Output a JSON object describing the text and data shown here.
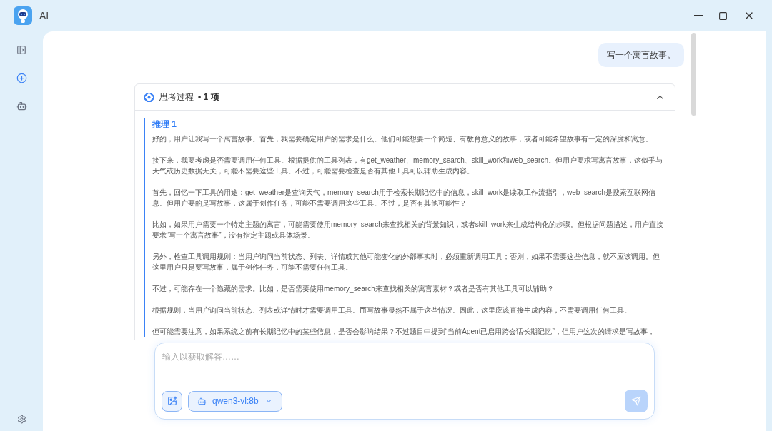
{
  "window": {
    "title": "AI"
  },
  "sidebar": {
    "items": [
      {
        "kind": "panel"
      },
      {
        "kind": "new-chat",
        "selected": true
      },
      {
        "kind": "agent",
        "selected": false
      }
    ]
  },
  "user_message": "写一个寓言故事。",
  "thinking": {
    "title": "思考过程",
    "count": "• 1 项",
    "expanded": true,
    "step_title": "推理 1",
    "paragraphs": [
      "好的，用户让我写一个寓言故事。首先，我需要确定用户的需求是什么。他们可能想要一个简短、有教育意义的故事，或者可能希望故事有一定的深度和寓意。",
      "接下来，我要考虑是否需要调用任何工具。根据提供的工具列表，有get_weather、memory_search、skill_work和web_search。但用户要求写寓言故事，这似乎与天气或历史数据无关，可能不需要这些工具。不过，可能需要检查是否有其他工具可以辅助生成内容。",
      "首先，回忆一下工具的用途：get_weather是查询天气，memory_search用于检索长期记忆中的信息，skill_work是读取工作流指引，web_search是搜索互联网信息。但用户要的是写故事，这属于创作任务，可能不需要调用这些工具。不过，是否有其他可能性？",
      "比如，如果用户需要一个特定主题的寓言，可能需要使用memory_search来查找相关的背景知识，或者skill_work来生成结构化的步骤。但根据问题描述，用户直接要求“写一个寓言故事”，没有指定主题或具体场景。",
      "另外，检查工具调用规则：当用户询问当前状态、列表、详情或其他可能变化的外部事实时，必须重新调用工具；否则，如果不需要这些信息，就不应该调用。但这里用户只是要写故事，属于创作任务，可能不需要任何工具。",
      "不过，可能存在一个隐藏的需求。比如，是否需要使用memory_search来查找相关的寓言素材？或者是否有其他工具可以辅助？",
      "根据规则，当用户询问当前状态、列表或详情时才需要调用工具。而写故事显然不属于这些情况。因此，这里应该直接生成内容，不需要调用任何工具。",
      "但可能需要注意，如果系统之前有长期记忆中的某些信息，是否会影响结果？不过题目中提到“当前Agent已启用跨会话长期记忆”，但用户这次的请求是写故事，"
    ]
  },
  "input": {
    "placeholder": "输入以获取解答……",
    "model": "qwen3-vl:8b",
    "send_disabled": true
  }
}
